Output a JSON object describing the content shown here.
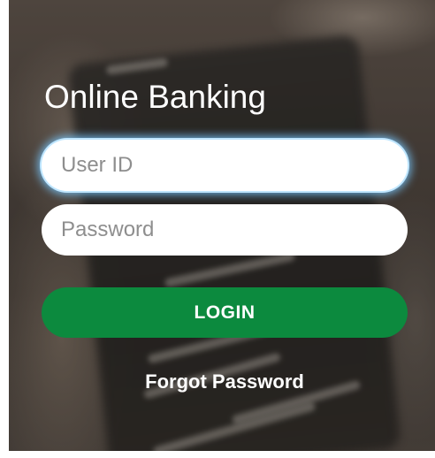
{
  "login": {
    "title": "Online Banking",
    "user_id": {
      "placeholder": "User ID",
      "value": ""
    },
    "password": {
      "placeholder": "Password",
      "value": ""
    },
    "login_label": "LOGIN",
    "forgot_password_label": "Forgot Password"
  },
  "colors": {
    "login_button": "#0c8a3e",
    "focus_glow": "#7cc8ff",
    "text": "#ffffff"
  }
}
